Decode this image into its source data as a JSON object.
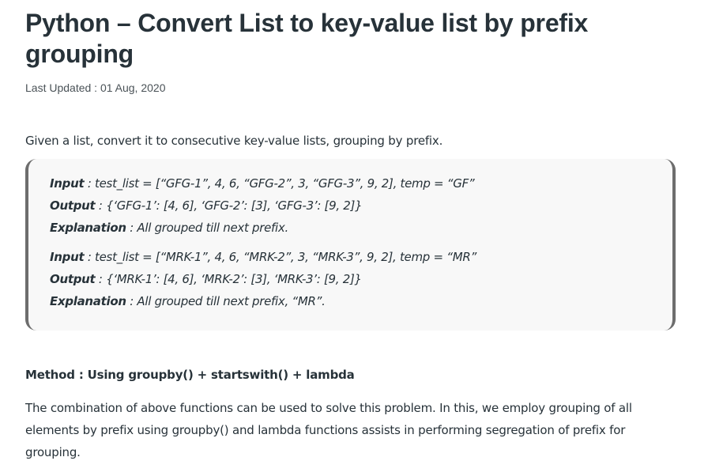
{
  "article": {
    "title": "Python – Convert List to key-value list by prefix grouping",
    "last_updated": "Last Updated : 01 Aug, 2020",
    "intro": "Given a list, convert it to consecutive key-value lists, grouping by prefix."
  },
  "examples": [
    {
      "input_label": "Input",
      "input_text": " : test_list = [“GFG-1”, 4, 6, “GFG-2”, 3, “GFG-3”, 9, 2], temp = “GF”",
      "output_label": "Output",
      "output_text": " : {‘GFG-1’: [4, 6], ‘GFG-2’: [3], ‘GFG-3’: [9, 2]}",
      "explanation_label": "Explanation",
      "explanation_text": " : All grouped till next prefix."
    },
    {
      "input_label": "Input",
      "input_text": " : test_list = [“MRK-1”, 4, 6, “MRK-2”, 3, “MRK-3”, 9, 2], temp = “MR”",
      "output_label": "Output",
      "output_text": " : {‘MRK-1’: [4, 6], ‘MRK-2’: [3], ‘MRK-3’: [9, 2]}",
      "explanation_label": "Explanation",
      "explanation_text": " : All grouped till next prefix, “MR”."
    }
  ],
  "method": {
    "heading": "Method : Using groupby() + startswith() + lambda",
    "description": "The combination of above functions can be used to solve this problem. In this, we employ grouping of all elements by prefix using groupby() and lambda functions assists in performing segregation of prefix for grouping."
  }
}
